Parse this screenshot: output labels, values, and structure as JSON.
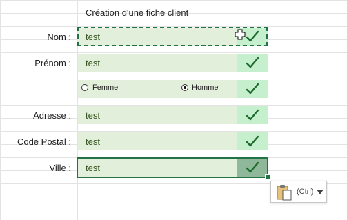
{
  "sheet": {
    "title": "Création d'une fiche client"
  },
  "form": {
    "rows": [
      {
        "label": "Nom :",
        "value": "test"
      },
      {
        "label": "Prénom :",
        "value": "test"
      },
      {
        "label": "",
        "value": ""
      },
      {
        "label": "Adresse :",
        "value": "test"
      },
      {
        "label": "Code Postal :",
        "value": "test"
      },
      {
        "label": "Ville :",
        "value": "test"
      }
    ],
    "gender": {
      "option_female": "Femme",
      "option_male": "Homme",
      "selected": "Homme"
    },
    "check_icon": "checkmark-icon"
  },
  "paste_options": {
    "label": "(Ctrl)",
    "icon": "clipboard-icon"
  },
  "colors": {
    "field_bg": "#e2efda",
    "check_bg": "#c6efce",
    "check_mark": "#1e6b2e",
    "selection": "#217346"
  }
}
